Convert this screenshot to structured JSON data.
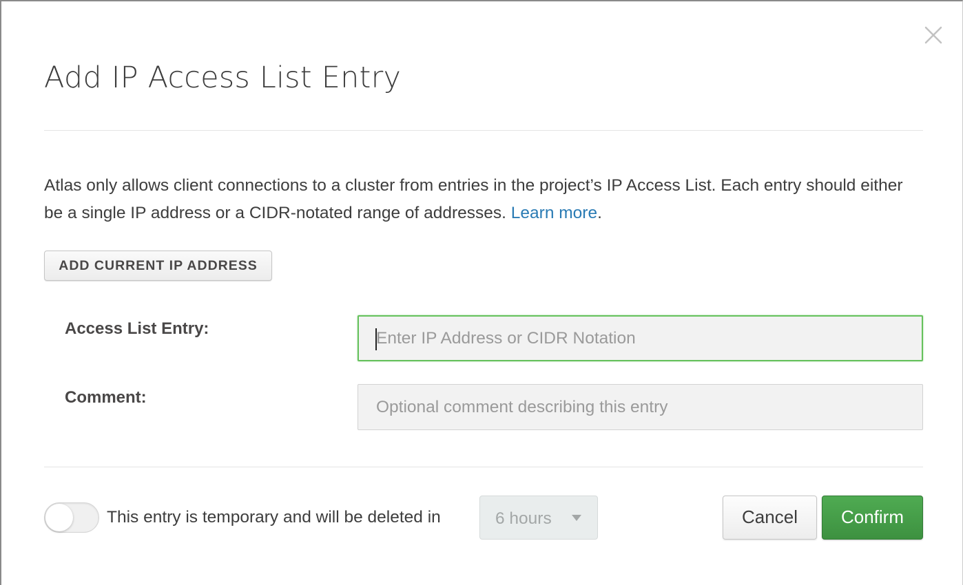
{
  "modal": {
    "title": "Add IP Access List Entry",
    "close_icon": "close-icon",
    "description": {
      "text": "Atlas only allows client connections to a cluster from entries in the project’s IP Access List. Each entry should either be a single IP address or a CIDR-notated range of addresses. ",
      "link_label": "Learn more",
      "trailing": "."
    },
    "add_current_ip_label": "ADD CURRENT IP ADDRESS",
    "fields": {
      "entry": {
        "label": "Access List Entry:",
        "placeholder": "Enter IP Address or CIDR Notation",
        "value": ""
      },
      "comment": {
        "label": "Comment:",
        "placeholder": "Optional comment describing this entry",
        "value": ""
      }
    },
    "temporary": {
      "enabled": false,
      "text": "This entry is temporary and will be deleted in",
      "duration": "6 hours",
      "chevron_icon": "chevron-down-icon"
    },
    "buttons": {
      "cancel": "Cancel",
      "confirm": "Confirm"
    },
    "colors": {
      "link": "#2a7bb4",
      "focus_border": "#65c15c",
      "confirm_bg": "#43a047"
    }
  }
}
